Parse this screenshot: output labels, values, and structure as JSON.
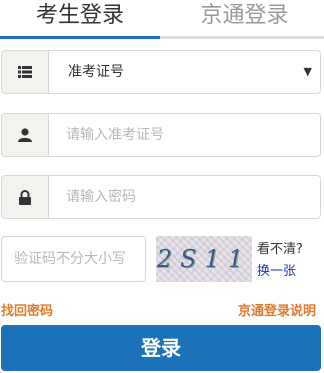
{
  "tabs": [
    {
      "label": "考生登录",
      "active": true
    },
    {
      "label": "京通登录",
      "active": false
    }
  ],
  "form": {
    "id_type": {
      "icon": "list-icon",
      "value": "准考证号",
      "options": [
        "准考证号"
      ]
    },
    "exam_number": {
      "icon": "user-icon",
      "placeholder": "请输入准考证号",
      "value": ""
    },
    "password": {
      "icon": "lock-icon",
      "placeholder": "请输入密码",
      "value": ""
    },
    "captcha": {
      "placeholder": "验证码不分大小写",
      "value": "",
      "image_text": "2S11",
      "hint": "看不清?",
      "refresh_label": "换一张"
    }
  },
  "links": {
    "forgot_password": "找回密码",
    "jingtong_help": "京通登录说明"
  },
  "submit_label": "登录",
  "colors": {
    "primary": "#1b72b8",
    "link_orange": "#e07a2e",
    "refresh_blue": "#1a3cc8"
  }
}
